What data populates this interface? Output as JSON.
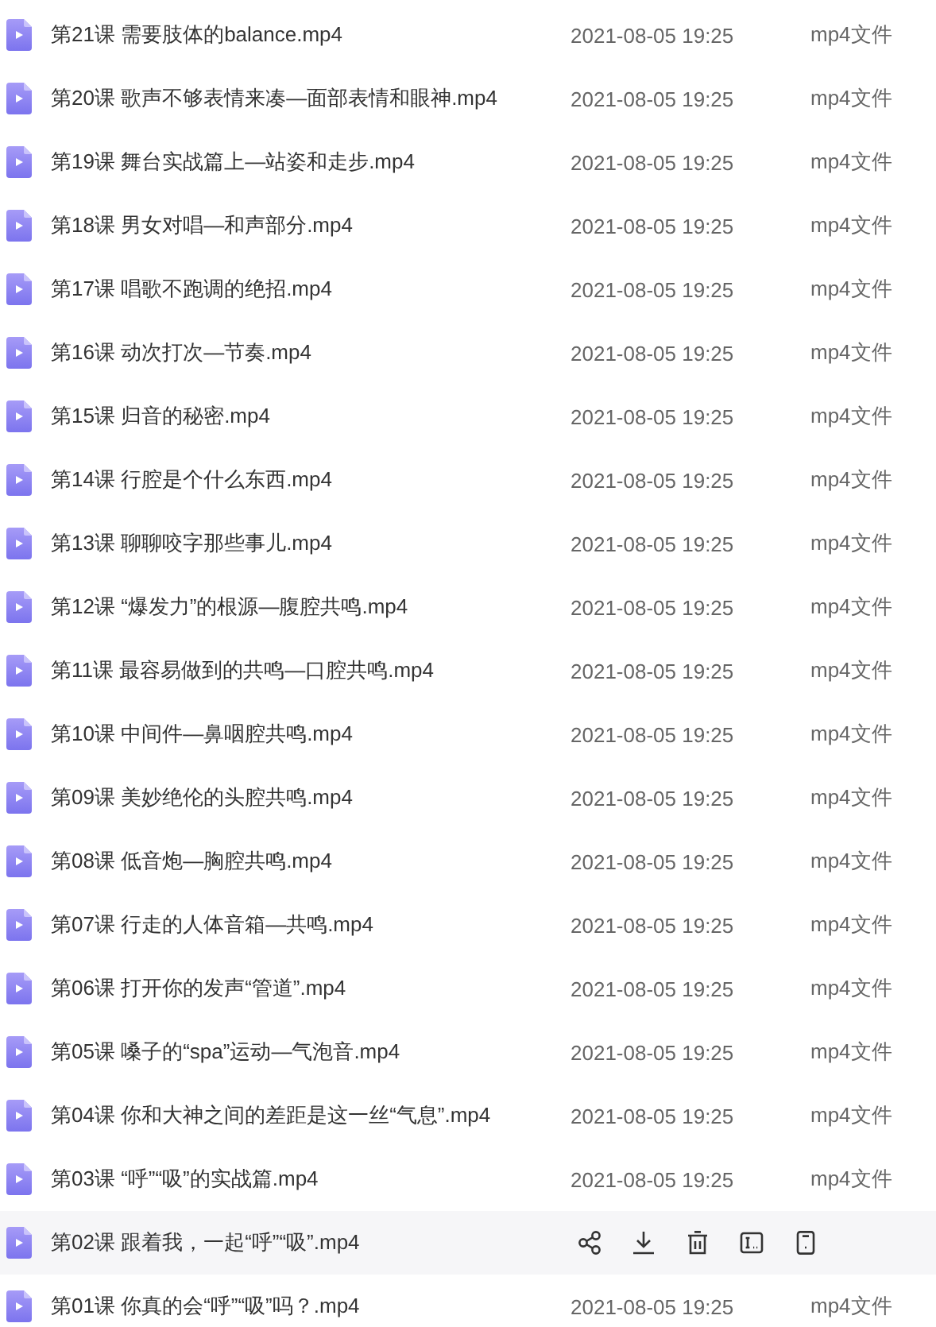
{
  "files": [
    {
      "name": "第21课 需要肢体的balance.mp4",
      "date": "2021-08-05 19:25",
      "type": "mp4文件",
      "hovered": false
    },
    {
      "name": "第20课 歌声不够表情来凑—面部表情和眼神.mp4",
      "date": "2021-08-05 19:25",
      "type": "mp4文件",
      "hovered": false
    },
    {
      "name": "第19课 舞台实战篇上—站姿和走步.mp4",
      "date": "2021-08-05 19:25",
      "type": "mp4文件",
      "hovered": false
    },
    {
      "name": "第18课 男女对唱—和声部分.mp4",
      "date": "2021-08-05 19:25",
      "type": "mp4文件",
      "hovered": false
    },
    {
      "name": "第17课 唱歌不跑调的绝招.mp4",
      "date": "2021-08-05 19:25",
      "type": "mp4文件",
      "hovered": false
    },
    {
      "name": "第16课 动次打次—节奏.mp4",
      "date": "2021-08-05 19:25",
      "type": "mp4文件",
      "hovered": false
    },
    {
      "name": "第15课 归音的秘密.mp4",
      "date": "2021-08-05 19:25",
      "type": "mp4文件",
      "hovered": false
    },
    {
      "name": "第14课 行腔是个什么东西.mp4",
      "date": "2021-08-05 19:25",
      "type": "mp4文件",
      "hovered": false
    },
    {
      "name": "第13课 聊聊咬字那些事儿.mp4",
      "date": "2021-08-05 19:25",
      "type": "mp4文件",
      "hovered": false
    },
    {
      "name": "第12课 “爆发力”的根源—腹腔共鸣.mp4",
      "date": "2021-08-05 19:25",
      "type": "mp4文件",
      "hovered": false
    },
    {
      "name": "第11课 最容易做到的共鸣—口腔共鸣.mp4",
      "date": "2021-08-05 19:25",
      "type": "mp4文件",
      "hovered": false
    },
    {
      "name": "第10课 中间件—鼻咽腔共鸣.mp4",
      "date": "2021-08-05 19:25",
      "type": "mp4文件",
      "hovered": false
    },
    {
      "name": "第09课 美妙绝伦的头腔共鸣.mp4",
      "date": "2021-08-05 19:25",
      "type": "mp4文件",
      "hovered": false
    },
    {
      "name": "第08课 低音炮—胸腔共鸣.mp4",
      "date": "2021-08-05 19:25",
      "type": "mp4文件",
      "hovered": false
    },
    {
      "name": "第07课 行走的人体音箱—共鸣.mp4",
      "date": "2021-08-05 19:25",
      "type": "mp4文件",
      "hovered": false
    },
    {
      "name": "第06课 打开你的发声“管道”.mp4",
      "date": "2021-08-05 19:25",
      "type": "mp4文件",
      "hovered": false
    },
    {
      "name": "第05课 嗓子的“spa”运动—气泡音.mp4",
      "date": "2021-08-05 19:25",
      "type": "mp4文件",
      "hovered": false
    },
    {
      "name": "第04课 你和大神之间的差距是这一丝“气息”.mp4",
      "date": "2021-08-05 19:25",
      "type": "mp4文件",
      "hovered": false
    },
    {
      "name": "第03课 “呼”“吸”的实战篇.mp4",
      "date": "2021-08-05 19:25",
      "type": "mp4文件",
      "hovered": false
    },
    {
      "name": "第02课 跟着我，一起“呼”“吸”.mp4",
      "hovered": true
    },
    {
      "name": "第01课 你真的会“呼”“吸”吗？.mp4",
      "date": "2021-08-05 19:25",
      "type": "mp4文件",
      "hovered": false
    }
  ]
}
